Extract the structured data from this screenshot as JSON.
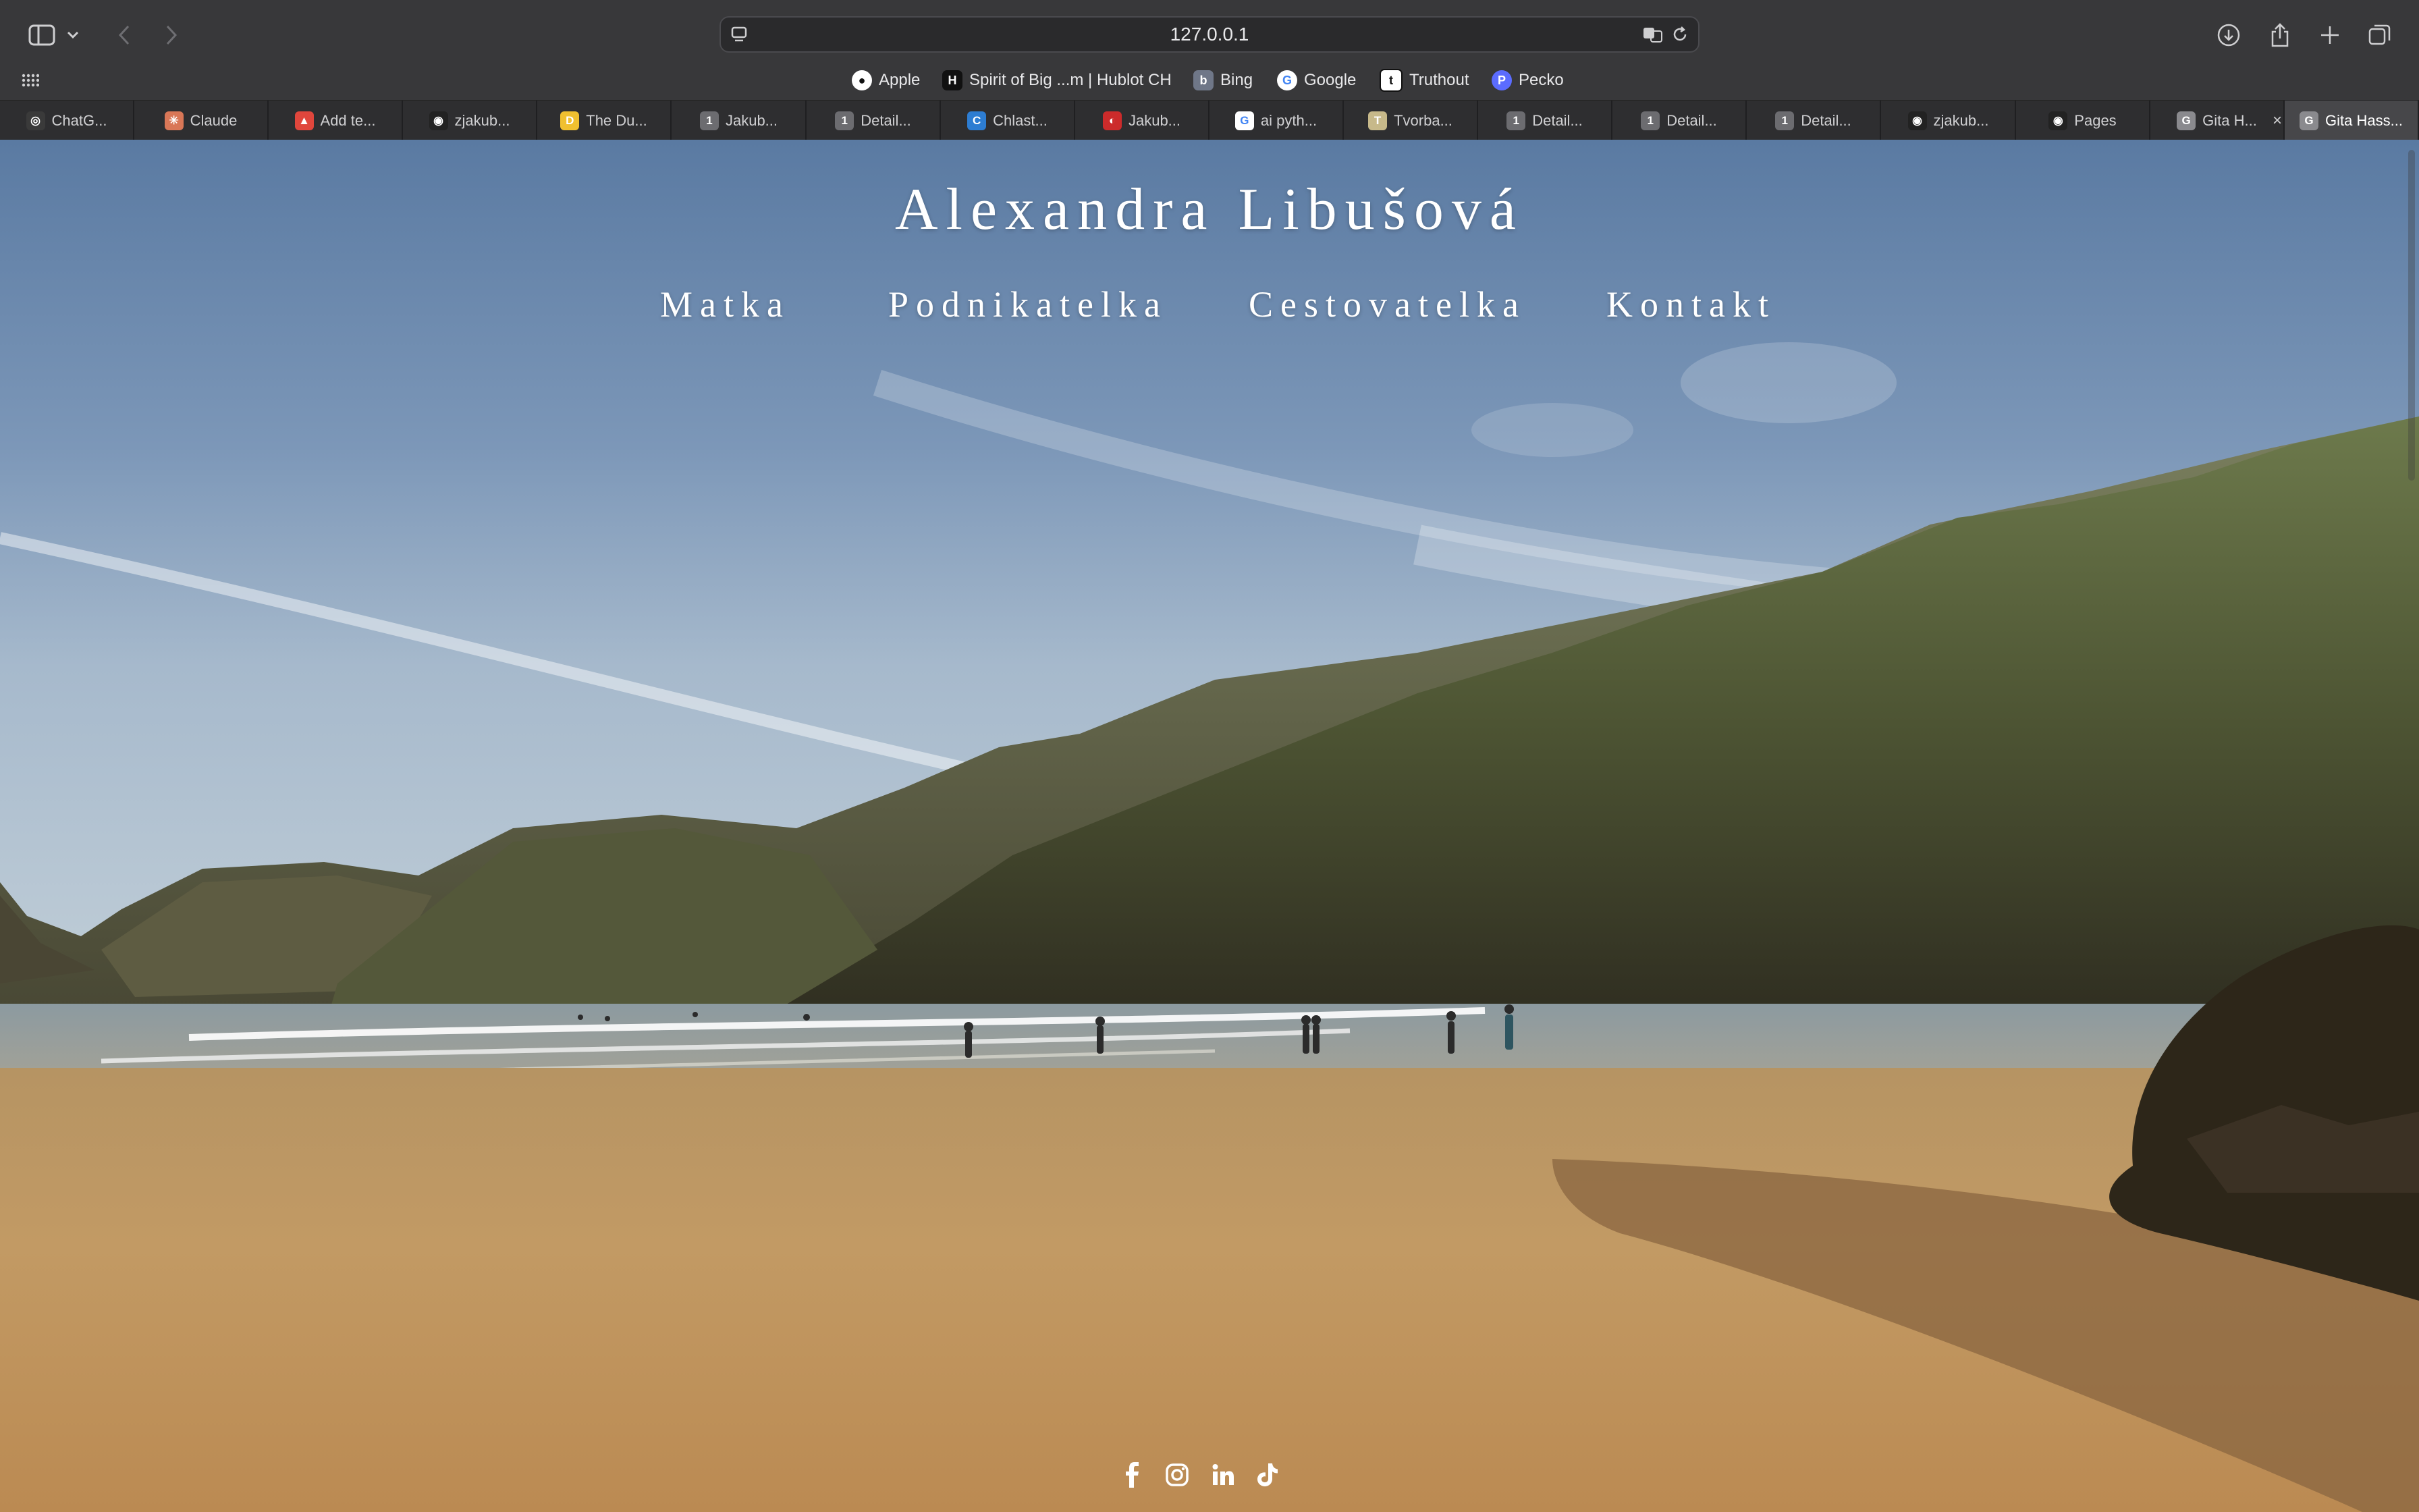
{
  "browser": {
    "url": "127.0.0.1",
    "favorites": [
      {
        "label": "Apple",
        "icon": "apple-icon",
        "color": "#ffffff"
      },
      {
        "label": "Spirit of Big ...m | Hublot CH",
        "icon": "hublot-icon",
        "color": "#111111"
      },
      {
        "label": "Bing",
        "icon": "bing-icon",
        "color": "#6f7788"
      },
      {
        "label": "Google",
        "icon": "google-icon",
        "color": "#ffffff"
      },
      {
        "label": "Truthout",
        "icon": "truthout-icon",
        "color": "#111111"
      },
      {
        "label": "Pecko",
        "icon": "pecko-icon",
        "color": "#5b6cff"
      }
    ],
    "tabs": [
      {
        "label": "ChatG...",
        "icon": "chatgpt-icon",
        "glyph": "◎",
        "color": "#3a3a3a"
      },
      {
        "label": "Claude",
        "icon": "claude-icon",
        "glyph": "✳",
        "color": "#d97757"
      },
      {
        "label": "Add te...",
        "icon": "add-icon",
        "glyph": "▲",
        "color": "#e0463c"
      },
      {
        "label": "zjakub...",
        "icon": "github-icon",
        "glyph": "◉",
        "color": "#222222"
      },
      {
        "label": "The Du...",
        "icon": "duolingo-icon",
        "glyph": "D",
        "color": "#f0c030"
      },
      {
        "label": "Jakub...",
        "icon": "one-icon",
        "glyph": "1",
        "color": "#6c6c70"
      },
      {
        "label": "Detail...",
        "icon": "one-icon",
        "glyph": "1",
        "color": "#6c6c70"
      },
      {
        "label": "Chlast...",
        "icon": "edge-icon",
        "glyph": "C",
        "color": "#2d7dd2"
      },
      {
        "label": "Jakub...",
        "icon": "jakub-icon",
        "glyph": "◐",
        "color": "#cc2b2b"
      },
      {
        "label": "ai pyth...",
        "icon": "google-icon",
        "glyph": "G",
        "color": "#ffffff"
      },
      {
        "label": "Tvorba...",
        "icon": "tvorba-icon",
        "glyph": "T",
        "color": "#c7b98a"
      },
      {
        "label": "Detail...",
        "icon": "one-icon",
        "glyph": "1",
        "color": "#6c6c70"
      },
      {
        "label": "Detail...",
        "icon": "one-icon",
        "glyph": "1",
        "color": "#6c6c70"
      },
      {
        "label": "Detail...",
        "icon": "one-icon",
        "glyph": "1",
        "color": "#6c6c70"
      },
      {
        "label": "zjakub...",
        "icon": "github-icon",
        "glyph": "◉",
        "color": "#222222"
      },
      {
        "label": "Pages",
        "icon": "github-icon",
        "glyph": "◉",
        "color": "#222222"
      },
      {
        "label": "Gita H...",
        "icon": "gita-icon",
        "glyph": "G",
        "color": "#8a8a8e"
      },
      {
        "label": "Gita Hass...",
        "icon": "gita-icon",
        "glyph": "G",
        "color": "#8a8a8e",
        "active": true
      }
    ]
  },
  "site": {
    "title": "Alexandra Libušová",
    "nav": [
      "Matka",
      "Podnikatelka",
      "Cestovatelka",
      "Kontakt"
    ],
    "social": [
      "facebook-icon",
      "instagram-icon",
      "linkedin-icon",
      "tiktok-icon"
    ]
  }
}
